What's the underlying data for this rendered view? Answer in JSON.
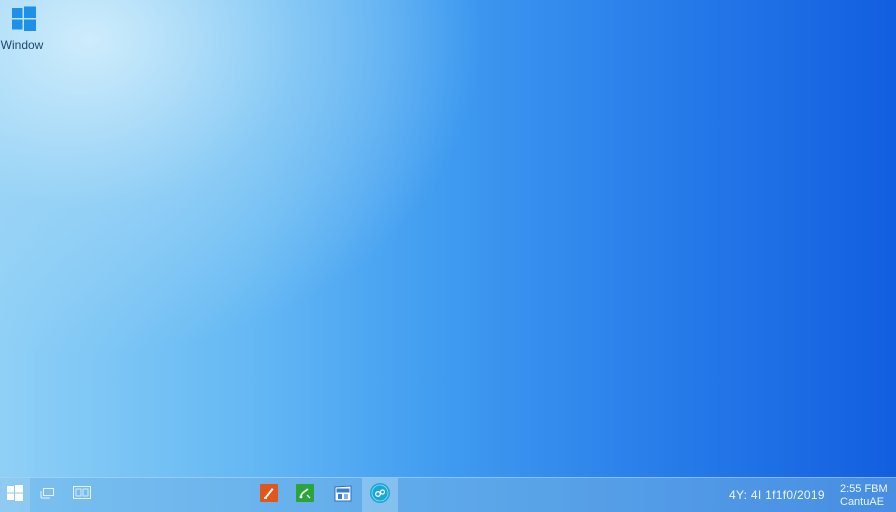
{
  "desktop": {
    "icons": [
      {
        "label": "Window",
        "icon": "windows-logo-icon"
      }
    ]
  },
  "taskbar": {
    "start_icon": "windows-start-icon",
    "task_view_icon": "task-view-icon",
    "show_desktop_icon": "monitor-icon",
    "apps": [
      {
        "icon": "orange-app-icon",
        "color": "#e0561c"
      },
      {
        "icon": "green-app-icon",
        "color": "#2aa53a"
      },
      {
        "icon": "store-app-icon",
        "color": "#3a7fc9"
      },
      {
        "icon": "teal-app-icon",
        "color": "#1aa7d6",
        "active": true
      }
    ],
    "date": "4Y: 4I 1f1f0/2019",
    "clock_line1": "2:55 FBM",
    "clock_line2": "CantuAE"
  },
  "colors": {
    "wallpaper_left": "#8fd0f6",
    "wallpaper_right": "#125ee0",
    "windows_blue": "#1e90e8"
  }
}
